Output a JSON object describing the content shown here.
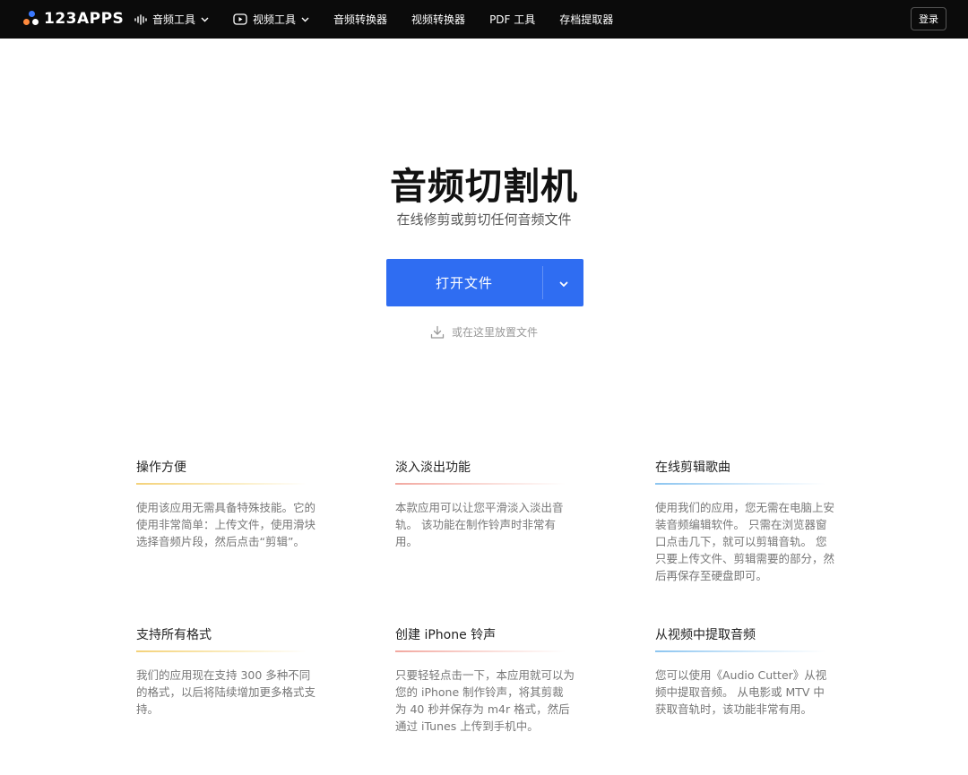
{
  "header": {
    "logo_text": "123APPS",
    "nav": [
      {
        "label": "音频工具",
        "icon": "audio-wave-icon",
        "dropdown": true
      },
      {
        "label": "视频工具",
        "icon": "video-play-icon",
        "dropdown": true
      },
      {
        "label": "音频转换器"
      },
      {
        "label": "视频转换器"
      },
      {
        "label": "PDF 工具"
      },
      {
        "label": "存档提取器"
      }
    ],
    "login_label": "登录"
  },
  "hero": {
    "title": "音频切割机",
    "subtitle": "在线修剪或剪切任何音频文件",
    "open_button_label": "打开文件",
    "drop_hint": "或在这里放置文件"
  },
  "features": [
    {
      "title": "操作方便",
      "text": "使用该应用无需具备特殊技能。它的使用非常简单：上传文件，使用滑块选择音频片段，然后点击“剪辑”。",
      "accent": "#f4d27a"
    },
    {
      "title": "淡入淡出功能",
      "text": "本款应用可以让您平滑淡入淡出音轨。 该功能在制作铃声时非常有用。",
      "accent": "#f2a8a0"
    },
    {
      "title": "在线剪辑歌曲",
      "text": "使用我们的应用，您无需在电脑上安装音频编辑软件。 只需在浏览器窗口点击几下，就可以剪辑音轨。 您只要上传文件、剪辑需要的部分，然后再保存至硬盘即可。",
      "accent": "#8cc5f0"
    },
    {
      "title": "支持所有格式",
      "text": "我们的应用现在支持 300 多种不同的格式，以后将陆续增加更多格式支持。",
      "accent": "#f4d27a"
    },
    {
      "title": "创建 iPhone 铃声",
      "text": "只要轻轻点击一下，本应用就可以为您的 iPhone 制作铃声，将其剪裁为 40 秒并保存为 m4r 格式，然后通过 iTunes 上传到手机中。",
      "accent": "#f2a8a0"
    },
    {
      "title": "从视频中提取音频",
      "text": "您可以使用《Audio Cutter》从视频中提取音频。 从电影或 MTV 中获取音轨时，该功能非常有用。",
      "accent": "#8cc5f0"
    }
  ]
}
